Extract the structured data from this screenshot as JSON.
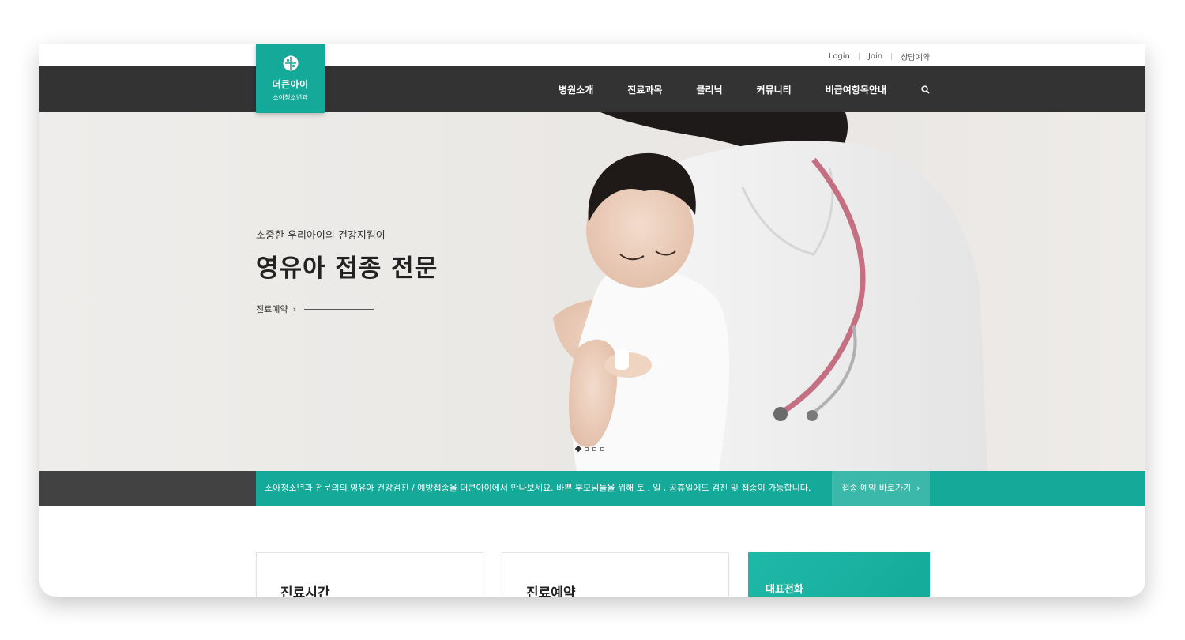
{
  "header": {
    "links": [
      "Login",
      "Join",
      "상담예약"
    ],
    "logo": {
      "name": "더큰아이",
      "sub": "소아청소년과"
    },
    "nav": [
      "병원소개",
      "진료과목",
      "클리닉",
      "커뮤니티",
      "비급여항목안내"
    ],
    "search_icon": "search-icon"
  },
  "hero": {
    "subtitle": "소중한 우리아이의 건강지킴이",
    "title": "영유아 접종 전문",
    "cta": "진료예약",
    "slides_total": 4,
    "slide_active": 1
  },
  "notice": {
    "message": "소아청소년과 전문의의 영유아 건강검진 / 예방접종을 더큰아이에서 만나보세요. 바쁜 부모님들을 위해 토 . 일 . 공휴일에도 검진 및 접종이 가능합니다.",
    "button": "접종 예약 바로가기"
  },
  "cards": [
    {
      "title": "진료시간"
    },
    {
      "title": "진료예약"
    },
    {
      "title": "대표전화"
    }
  ],
  "colors": {
    "brand": "#14a999",
    "nav_bg": "#333333",
    "notice_dark": "#424242"
  }
}
